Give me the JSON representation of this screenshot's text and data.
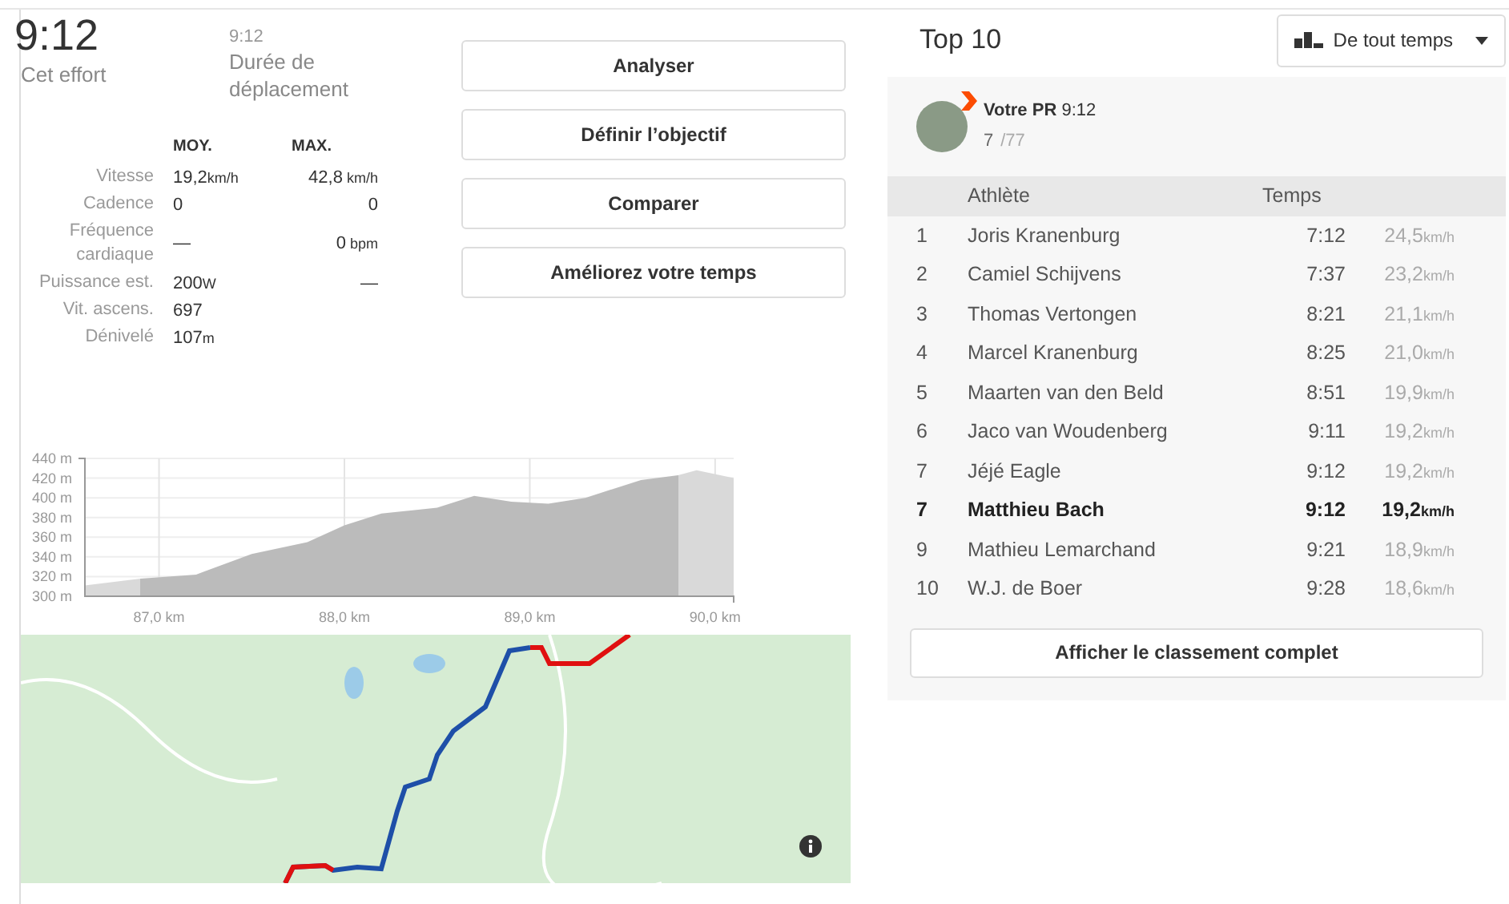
{
  "effort": {
    "time": "9:12",
    "label": "Cet effort"
  },
  "moving": {
    "time": "9:12",
    "label": "Durée de déplacement"
  },
  "stats": {
    "columns": [
      "MOY.",
      "MAX."
    ],
    "rows": [
      {
        "label": "Vitesse",
        "avg": "19,2",
        "avg_unit": "km/h",
        "max": "42,8",
        "max_unit": "km/h"
      },
      {
        "label": "Cadence",
        "avg": "0",
        "avg_unit": "",
        "max": "0",
        "max_unit": ""
      },
      {
        "label": "Fréquence cardiaque",
        "avg": "—",
        "avg_unit": "",
        "max": "0",
        "max_unit": "bpm"
      },
      {
        "label": "Puissance est.",
        "avg": "200",
        "avg_unit": "W",
        "max": "—",
        "max_unit": ""
      },
      {
        "label": "Vit. ascens.",
        "avg": "697",
        "avg_unit": "",
        "max": "",
        "max_unit": ""
      },
      {
        "label": "Dénivelé",
        "avg": "107",
        "avg_unit": "m",
        "max": "",
        "max_unit": ""
      }
    ]
  },
  "actions": [
    "Analyser",
    "Définir l’objectif",
    "Comparer",
    "Améliorez votre temps"
  ],
  "elevation": {
    "chart_data": {
      "type": "area",
      "x": [
        86.6,
        86.9,
        87.2,
        87.5,
        87.8,
        88.0,
        88.2,
        88.5,
        88.7,
        88.9,
        89.1,
        89.3,
        89.6,
        89.8,
        89.9,
        90.1
      ],
      "grid": true,
      "series": [
        {
          "color": "#bbbbbb",
          "values": [
            311,
            318,
            322,
            343,
            355,
            372,
            384,
            390,
            402,
            396,
            394,
            400,
            418,
            423,
            428,
            420
          ]
        }
      ],
      "xlim": [
        86.6,
        90.1
      ],
      "ylim": [
        300,
        440
      ],
      "xticks": [
        {
          "value": 87,
          "label": "87,0 km"
        },
        {
          "value": 88,
          "label": "88,0 km"
        },
        {
          "value": 89,
          "label": "89,0 km"
        },
        {
          "value": 90,
          "label": "90,0 km"
        }
      ],
      "yticks": [
        {
          "value": 300,
          "label": "300 m"
        },
        {
          "value": 320,
          "label": "320 m"
        },
        {
          "value": 340,
          "label": "340 m"
        },
        {
          "value": 360,
          "label": "360 m"
        },
        {
          "value": 380,
          "label": "380 m"
        },
        {
          "value": 400,
          "label": "400 m"
        },
        {
          "value": 420,
          "label": "420 m"
        },
        {
          "value": 440,
          "label": "440 m"
        }
      ]
    }
  },
  "leaderboard": {
    "title": "Top 10",
    "filter": "De tout temps",
    "pr": {
      "label": "**Votre PR** 9:12",
      "rank": "7",
      "total": "/77"
    },
    "columns": [
      "Athlète",
      "Temps"
    ],
    "rows": [
      {
        "rank": "1",
        "name": "Joris Kranenburg",
        "time": "7:12",
        "speed": "24,5",
        "unit": "km/h",
        "selected": false
      },
      {
        "rank": "2",
        "name": "Camiel Schijvens",
        "time": "7:37",
        "speed": "23,2",
        "unit": "km/h",
        "selected": false
      },
      {
        "rank": "3",
        "name": "Thomas Vertongen",
        "time": "8:21",
        "speed": "21,1",
        "unit": "km/h",
        "selected": false
      },
      {
        "rank": "4",
        "name": "Marcel Kranenburg",
        "time": "8:25",
        "speed": "21,0",
        "unit": "km/h",
        "selected": false
      },
      {
        "rank": "5",
        "name": "Maarten van den Beld",
        "time": "8:51",
        "speed": "19,9",
        "unit": "km/h",
        "selected": false
      },
      {
        "rank": "6",
        "name": "Jaco van Woudenberg",
        "time": "9:11",
        "speed": "19,2",
        "unit": "km/h",
        "selected": false
      },
      {
        "rank": "7",
        "name": "Jéjé Eagle",
        "time": "9:12",
        "speed": "19,2",
        "unit": "km/h",
        "selected": false
      },
      {
        "rank": "7",
        "name": "Matthieu Bach",
        "time": "9:12",
        "speed": "19,2",
        "unit": "km/h",
        "selected": true
      },
      {
        "rank": "9",
        "name": "Mathieu Lemarchand",
        "time": "9:21",
        "speed": "18,9",
        "unit": "km/h",
        "selected": false
      },
      {
        "rank": "10",
        "name": "W.J. de Boer",
        "time": "9:28",
        "speed": "18,6",
        "unit": "km/h",
        "selected": false
      }
    ],
    "full_button": "Afficher le classement complet"
  }
}
